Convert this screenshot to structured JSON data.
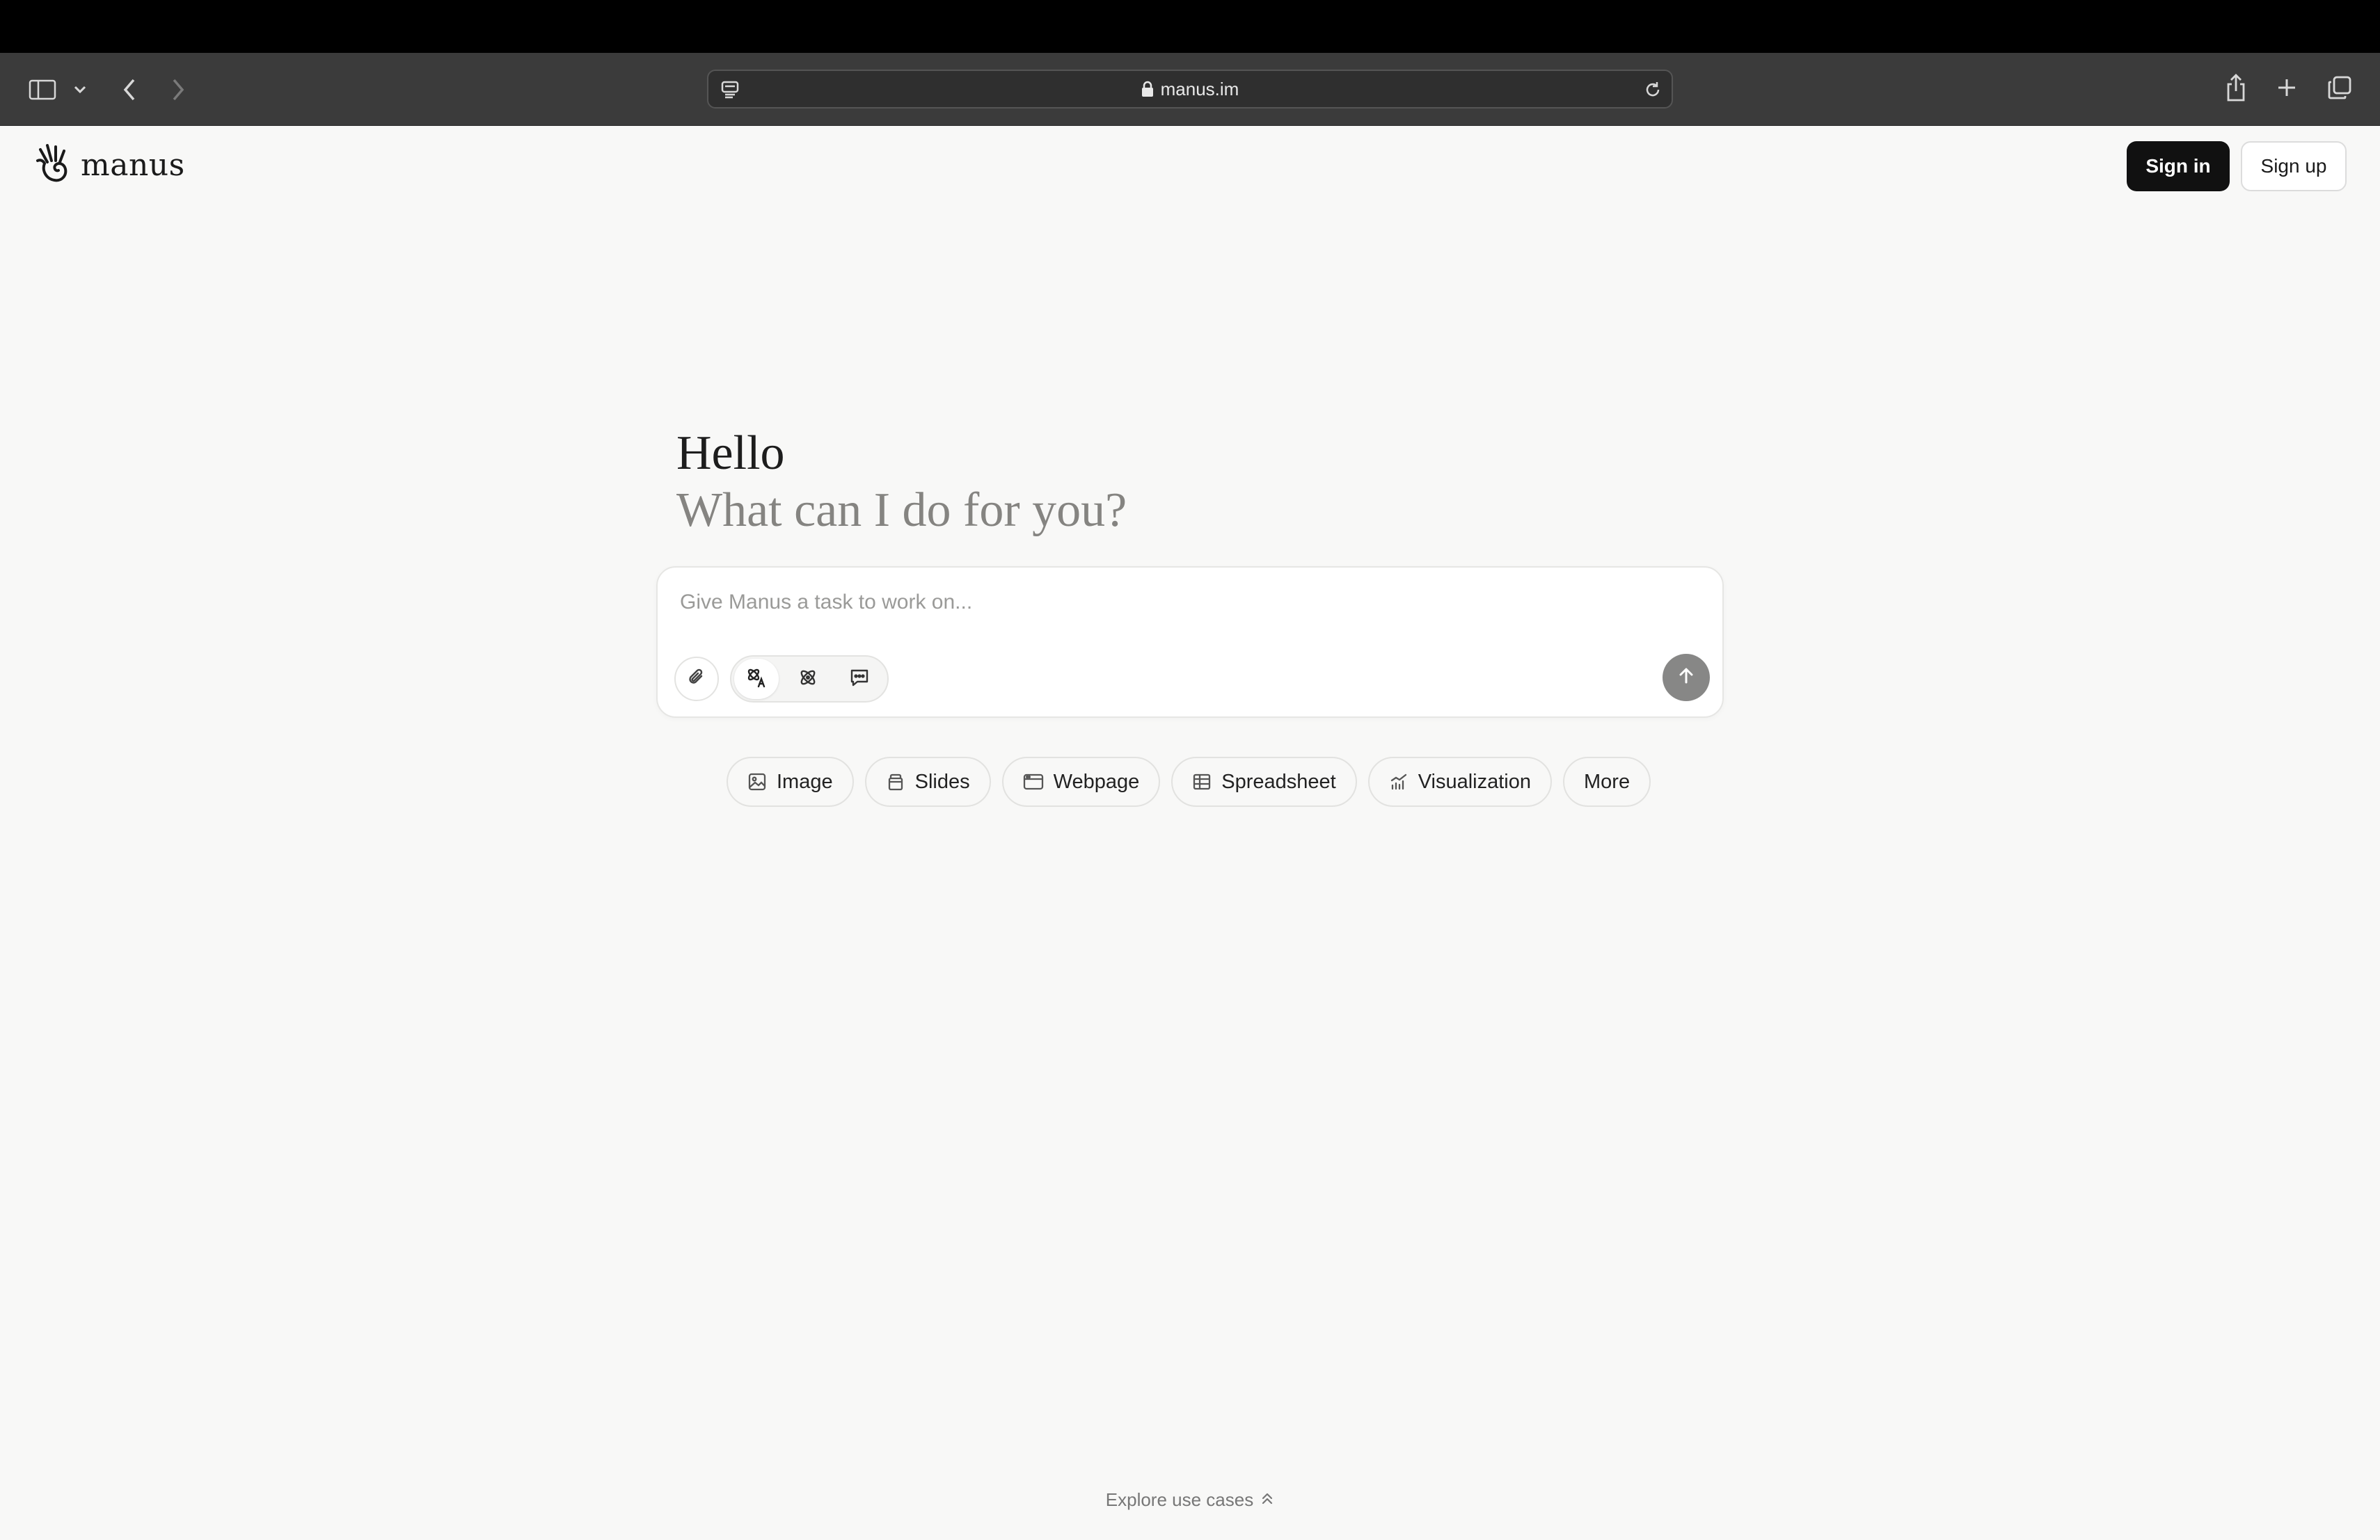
{
  "browser": {
    "address": "manus.im"
  },
  "header": {
    "logo_text": "manus",
    "sign_in": "Sign in",
    "sign_up": "Sign up"
  },
  "hero": {
    "title": "Hello",
    "subtitle": "What can I do for you?"
  },
  "composer": {
    "placeholder": "Give Manus a task to work on..."
  },
  "chips": [
    {
      "label": "Image",
      "icon": "image-icon"
    },
    {
      "label": "Slides",
      "icon": "slides-icon"
    },
    {
      "label": "Webpage",
      "icon": "webpage-icon"
    },
    {
      "label": "Spreadsheet",
      "icon": "spreadsheet-icon"
    },
    {
      "label": "Visualization",
      "icon": "chart-icon"
    },
    {
      "label": "More",
      "icon": ""
    }
  ],
  "footer": {
    "explore": "Explore use cases"
  },
  "colors": {
    "background": "#f8f8f7",
    "primary_button": "#111111",
    "send_button": "#878786"
  }
}
